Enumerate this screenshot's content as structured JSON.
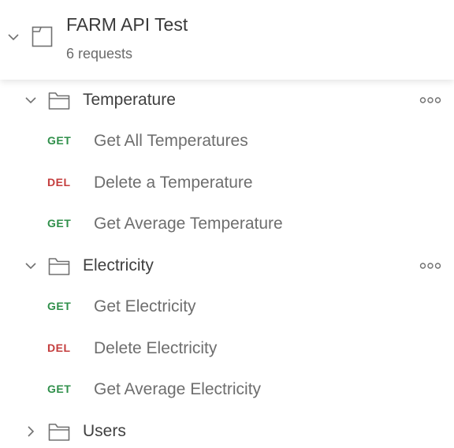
{
  "collection": {
    "name": "FARM API Test",
    "request_count": "6 requests",
    "expanded": true
  },
  "colors": {
    "get": "#2f8f4a",
    "del": "#c43d3d",
    "icon": "#707070"
  },
  "folders": [
    {
      "name": "Temperature",
      "expanded": true,
      "requests": [
        {
          "method": "GET",
          "name": "Get All Temperatures"
        },
        {
          "method": "DEL",
          "name": "Delete a Temperature"
        },
        {
          "method": "GET",
          "name": "Get Average Temperature"
        }
      ]
    },
    {
      "name": "Electricity",
      "expanded": true,
      "requests": [
        {
          "method": "GET",
          "name": "Get Electricity"
        },
        {
          "method": "DEL",
          "name": "Delete Electricity"
        },
        {
          "method": "GET",
          "name": "Get Average Electricity"
        }
      ]
    },
    {
      "name": "Users",
      "expanded": false,
      "requests": []
    }
  ]
}
